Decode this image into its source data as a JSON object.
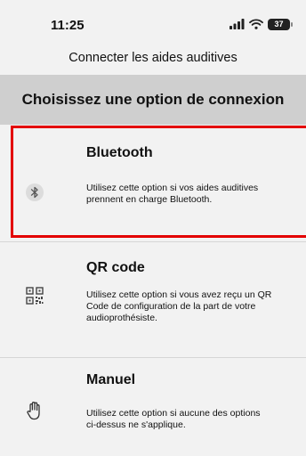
{
  "status_bar": {
    "time": "11:25",
    "battery": "37"
  },
  "header": {
    "title": "Connecter les aides auditives"
  },
  "section": {
    "title": "Choisissez une option de connexion"
  },
  "options": [
    {
      "icon": "bluetooth-icon",
      "title": "Bluetooth",
      "description": "Utilisez cette option si vos aides auditives\nprennent en charge Bluetooth.",
      "highlighted": true
    },
    {
      "icon": "qr-code-icon",
      "title": "QR code",
      "description": "Utilisez cette option si vous avez reçu un QR\nCode de configuration de la part de votre\naudioprothésiste."
    },
    {
      "icon": "hand-icon",
      "title": "Manuel",
      "description": "Utilisez cette option si aucune des options\nci-dessus ne s'applique."
    }
  ],
  "colors": {
    "highlight": "#e30000",
    "section_bg": "#cfcfcf",
    "page_bg": "#f2f2f2"
  }
}
